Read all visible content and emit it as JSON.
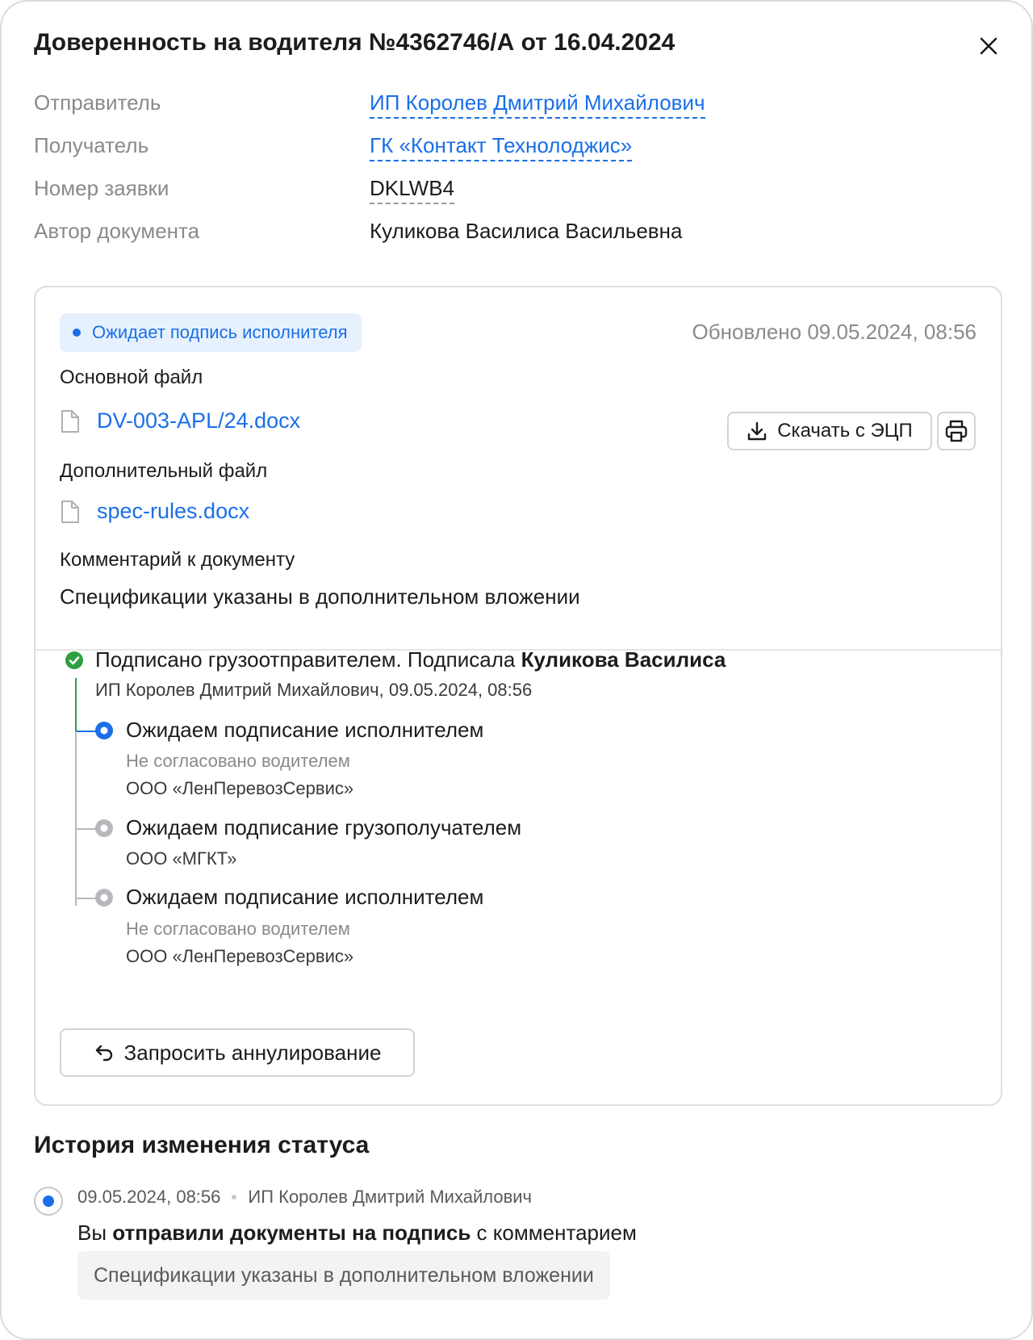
{
  "modal": {
    "title": "Доверенность на водителя №4362746/А от 16.04.2024"
  },
  "meta": {
    "sender_label": "Отправитель",
    "sender_value": "ИП Королев Дмитрий Михайлович",
    "recipient_label": "Получатель",
    "recipient_value": "ГК «Контакт Технолоджис»",
    "request_label": "Номер заявки",
    "request_value": "DKLWB4",
    "author_label": "Автор документа",
    "author_value": "Куликова Василиса Васильевна"
  },
  "card": {
    "status": "Ожидает подпись исполнителя",
    "updated": "Обновлено 09.05.2024, 08:56",
    "main_file_label": "Основной файл",
    "main_file_name": "DV-003-APL/24.docx",
    "download_label": "Скачать с ЭЦП",
    "extra_file_label": "Дополнительный файл",
    "extra_file_name": "spec-rules.docx",
    "comment_label": "Комментарий к документу",
    "comment_text": "Спецификации указаны в дополнительном вложении",
    "colors": {
      "accent": "#1a6fe8",
      "success": "#2e9e3e",
      "pending": "#b8b8bc"
    }
  },
  "timeline": {
    "signed": {
      "title_prefix": "Подписано грузоотправителем. Подписала ",
      "title_strong": "Куликова Василиса",
      "sub": "ИП Королев Дмитрий Михайлович, 09.05.2024, 08:56"
    },
    "steps": [
      {
        "title": "Ожидаем подписание исполнителем",
        "note": "Не согласовано водителем",
        "org": "ООО «ЛенПеревозСервис»",
        "state": "active"
      },
      {
        "title": "Ожидаем подписание грузополучателем",
        "note": "",
        "org": "ООО «МГКТ»",
        "state": "pending"
      },
      {
        "title": "Ожидаем подписание исполнителем",
        "note": "Не согласовано водителем",
        "org": "ООО «ЛенПеревозСервис»",
        "state": "pending"
      }
    ],
    "annul_label": "Запросить аннулирование"
  },
  "history": {
    "title": "История изменения статуса",
    "timestamp": "09.05.2024, 08:56",
    "actor": "ИП Королев Дмитрий Михайлович",
    "text_prefix": "Вы ",
    "text_strong": "отправили документы на подпись",
    "text_suffix": " с комментарием",
    "comment": "Спецификации указаны в дополнительном вложении"
  }
}
